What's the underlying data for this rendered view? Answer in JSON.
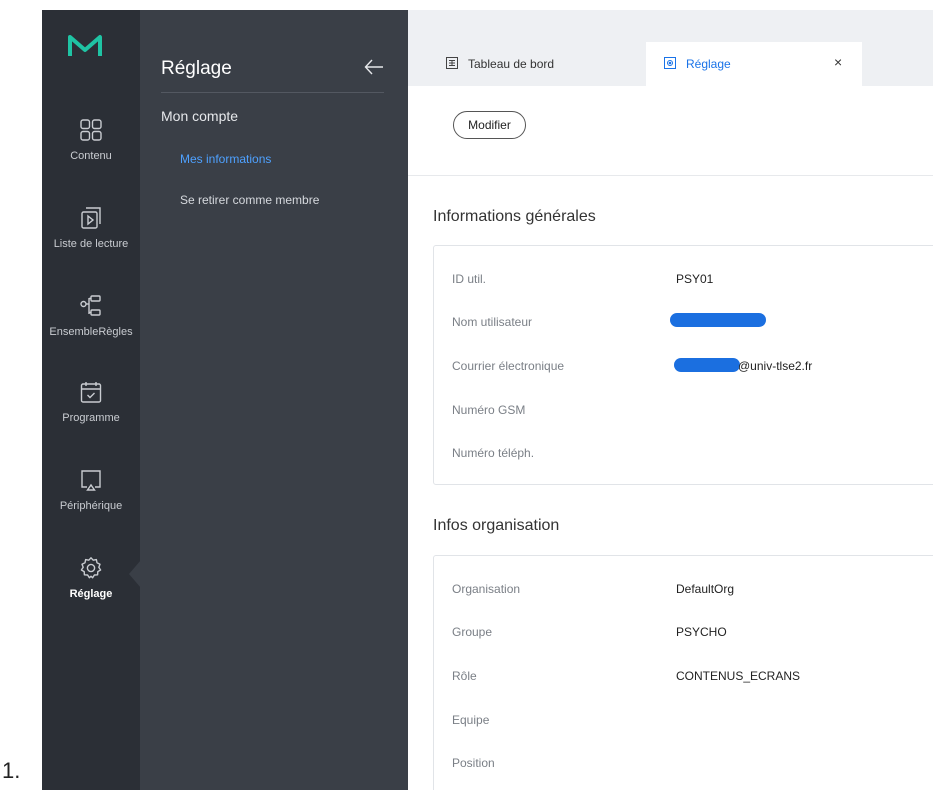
{
  "list_prefix": "1.",
  "brand": {
    "logo_letter": "M",
    "accent": "#1fc4a4"
  },
  "rail": {
    "items": [
      {
        "label": "Contenu",
        "icon": "grid-icon"
      },
      {
        "label": "Liste de lecture",
        "icon": "playlist-icon"
      },
      {
        "label": "EnsembleRègles",
        "icon": "rules-tree-icon"
      },
      {
        "label": "Programme",
        "icon": "calendar-check-icon"
      },
      {
        "label": "Périphérique",
        "icon": "monitor-icon"
      },
      {
        "label": "Réglage",
        "icon": "gear-icon",
        "active": true
      }
    ]
  },
  "panel": {
    "title": "Réglage",
    "section": "Mon compte",
    "links": [
      {
        "label": "Mes informations",
        "active": true
      },
      {
        "label": "Se retirer comme membre",
        "active": false
      }
    ]
  },
  "tabs": [
    {
      "label": "Tableau de bord",
      "icon": "dashboard-icon"
    },
    {
      "label": "Réglage",
      "icon": "settings-tab-icon",
      "active": true,
      "close": "×"
    }
  ],
  "actions": {
    "modify_label": "Modifier"
  },
  "general": {
    "title": "Informations générales",
    "rows": [
      {
        "key": "ID util.",
        "value": "PSY01"
      },
      {
        "key": "Nom utilisateur",
        "value": ""
      },
      {
        "key": "Courrier électronique",
        "value": "@univ-tlse2.fr"
      },
      {
        "key": "Numéro GSM",
        "value": ""
      },
      {
        "key": "Numéro téléph.",
        "value": ""
      }
    ]
  },
  "org": {
    "title": "Infos organisation",
    "rows": [
      {
        "key": "Organisation",
        "value": "DefaultOrg"
      },
      {
        "key": "Groupe",
        "value": "PSYCHO"
      },
      {
        "key": "Rôle",
        "value": "CONTENUS_ECRANS"
      },
      {
        "key": "Equipe",
        "value": ""
      },
      {
        "key": "Position",
        "value": ""
      }
    ]
  },
  "colors": {
    "rail_bg": "#2b2f36",
    "panel_bg": "#3a3f47",
    "active_link": "#4ea1ff",
    "active_tab": "#1a73e8",
    "redaction": "#1b6fe0"
  }
}
